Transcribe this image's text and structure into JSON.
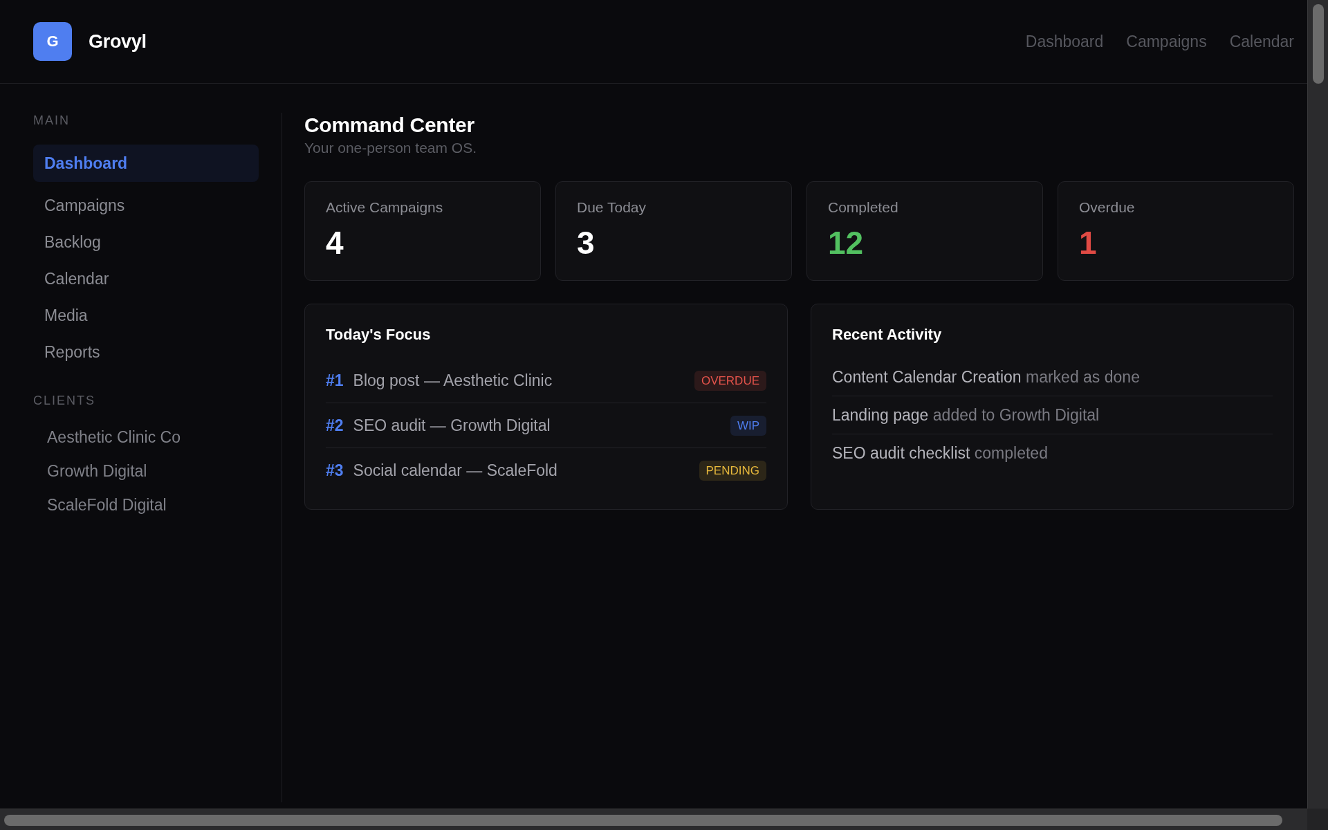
{
  "header": {
    "logo": {
      "letter": "G",
      "name": "Grovyl"
    },
    "nav": [
      "Dashboard",
      "Campaigns",
      "Calendar"
    ]
  },
  "sidebar": {
    "main": {
      "heading": "MAIN",
      "items": [
        {
          "label": "Dashboard",
          "selected": true
        },
        {
          "label": "Campaigns",
          "selected": false
        },
        {
          "label": "Backlog",
          "selected": false
        },
        {
          "label": "Calendar",
          "selected": false
        },
        {
          "label": "Media",
          "selected": false
        },
        {
          "label": "Reports",
          "selected": false
        }
      ]
    },
    "clients": {
      "heading": "CLIENTS",
      "items": [
        "Aesthetic Clinic Co",
        "Growth Digital",
        "ScaleFold Digital"
      ]
    }
  },
  "page": {
    "title": "Command Center",
    "subtitle": "Your one-person team OS."
  },
  "stats": [
    {
      "label": "Active Campaigns",
      "value": "4",
      "color": "#ffffff"
    },
    {
      "label": "Due Today",
      "value": "3",
      "color": "#ffffff"
    },
    {
      "label": "Completed",
      "value": "12",
      "color": "#52c060"
    },
    {
      "label": "Overdue",
      "value": "1",
      "color": "#e04a44"
    }
  ],
  "focus": {
    "title": "Today's Focus",
    "items": [
      {
        "rank": "#1",
        "title": "Blog post — Aesthetic Clinic",
        "badge": "OVERDUE",
        "color": "#e5534b"
      },
      {
        "rank": "#2",
        "title": "SEO audit — Growth Digital",
        "badge": "WIP",
        "color": "#4f7ef0"
      },
      {
        "rank": "#3",
        "title": "Social calendar — ScaleFold",
        "badge": "PENDING",
        "color": "#e8b93c"
      }
    ]
  },
  "activity": {
    "title": "Recent Activity",
    "items": [
      {
        "subject": "Content Calendar Creation",
        "action": "marked as done"
      },
      {
        "subject": "Landing page",
        "action": "added to Growth Digital"
      },
      {
        "subject": "SEO audit checklist",
        "action": "completed"
      }
    ]
  }
}
